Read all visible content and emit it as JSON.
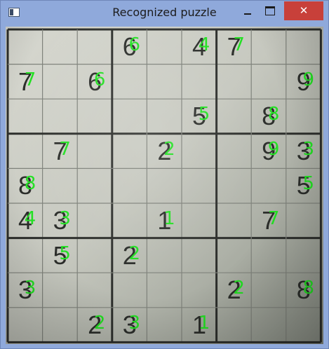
{
  "window": {
    "title": "Recognized puzzle",
    "close_glyph": "✕",
    "icons": {
      "app": "app-window-icon",
      "minimize": "minimize-icon",
      "maximize": "maximize-icon",
      "close": "close-icon"
    },
    "colors": {
      "frame": "#8fa9db",
      "close_button": "#c8403a",
      "recognized_digit": "#22e022",
      "printed_digit": "#2b2d2a"
    }
  },
  "puzzle": {
    "rows": [
      [
        "",
        "",
        "",
        "6",
        "",
        "4",
        "7",
        "",
        ""
      ],
      [
        "7",
        "",
        "6",
        "",
        "",
        "",
        "",
        "",
        "9"
      ],
      [
        "",
        "",
        "",
        "",
        "",
        "5",
        "",
        "8",
        ""
      ],
      [
        "",
        "7",
        "",
        "",
        "2",
        "",
        "",
        "9",
        "3"
      ],
      [
        "8",
        "",
        "",
        "",
        "",
        "",
        "",
        "",
        "5"
      ],
      [
        "4",
        "3",
        "",
        "",
        "1",
        "",
        "",
        "7",
        ""
      ],
      [
        "",
        "5",
        "",
        "2",
        "",
        "",
        "",
        "",
        ""
      ],
      [
        "3",
        "",
        "",
        "",
        "",
        "",
        "2",
        "",
        "8"
      ],
      [
        "",
        "",
        "2",
        "3",
        "",
        "1",
        "",
        "",
        ""
      ]
    ],
    "recognized": [
      [
        "",
        "",
        "",
        "6",
        "",
        "4",
        "7",
        "",
        ""
      ],
      [
        "7",
        "",
        "6",
        "",
        "",
        "",
        "",
        "",
        "9"
      ],
      [
        "",
        "",
        "",
        "",
        "",
        "5",
        "",
        "8",
        ""
      ],
      [
        "",
        "7",
        "",
        "",
        "2",
        "",
        "",
        "9",
        "3"
      ],
      [
        "8",
        "",
        "",
        "",
        "",
        "",
        "",
        "",
        "5"
      ],
      [
        "4",
        "3",
        "",
        "",
        "1",
        "",
        "",
        "7",
        ""
      ],
      [
        "",
        "5",
        "",
        "2",
        "",
        "",
        "",
        "",
        ""
      ],
      [
        "3",
        "",
        "",
        "",
        "",
        "",
        "2",
        "",
        "8"
      ],
      [
        "",
        "",
        "2",
        "3",
        "",
        "1",
        "",
        "",
        ""
      ]
    ]
  }
}
